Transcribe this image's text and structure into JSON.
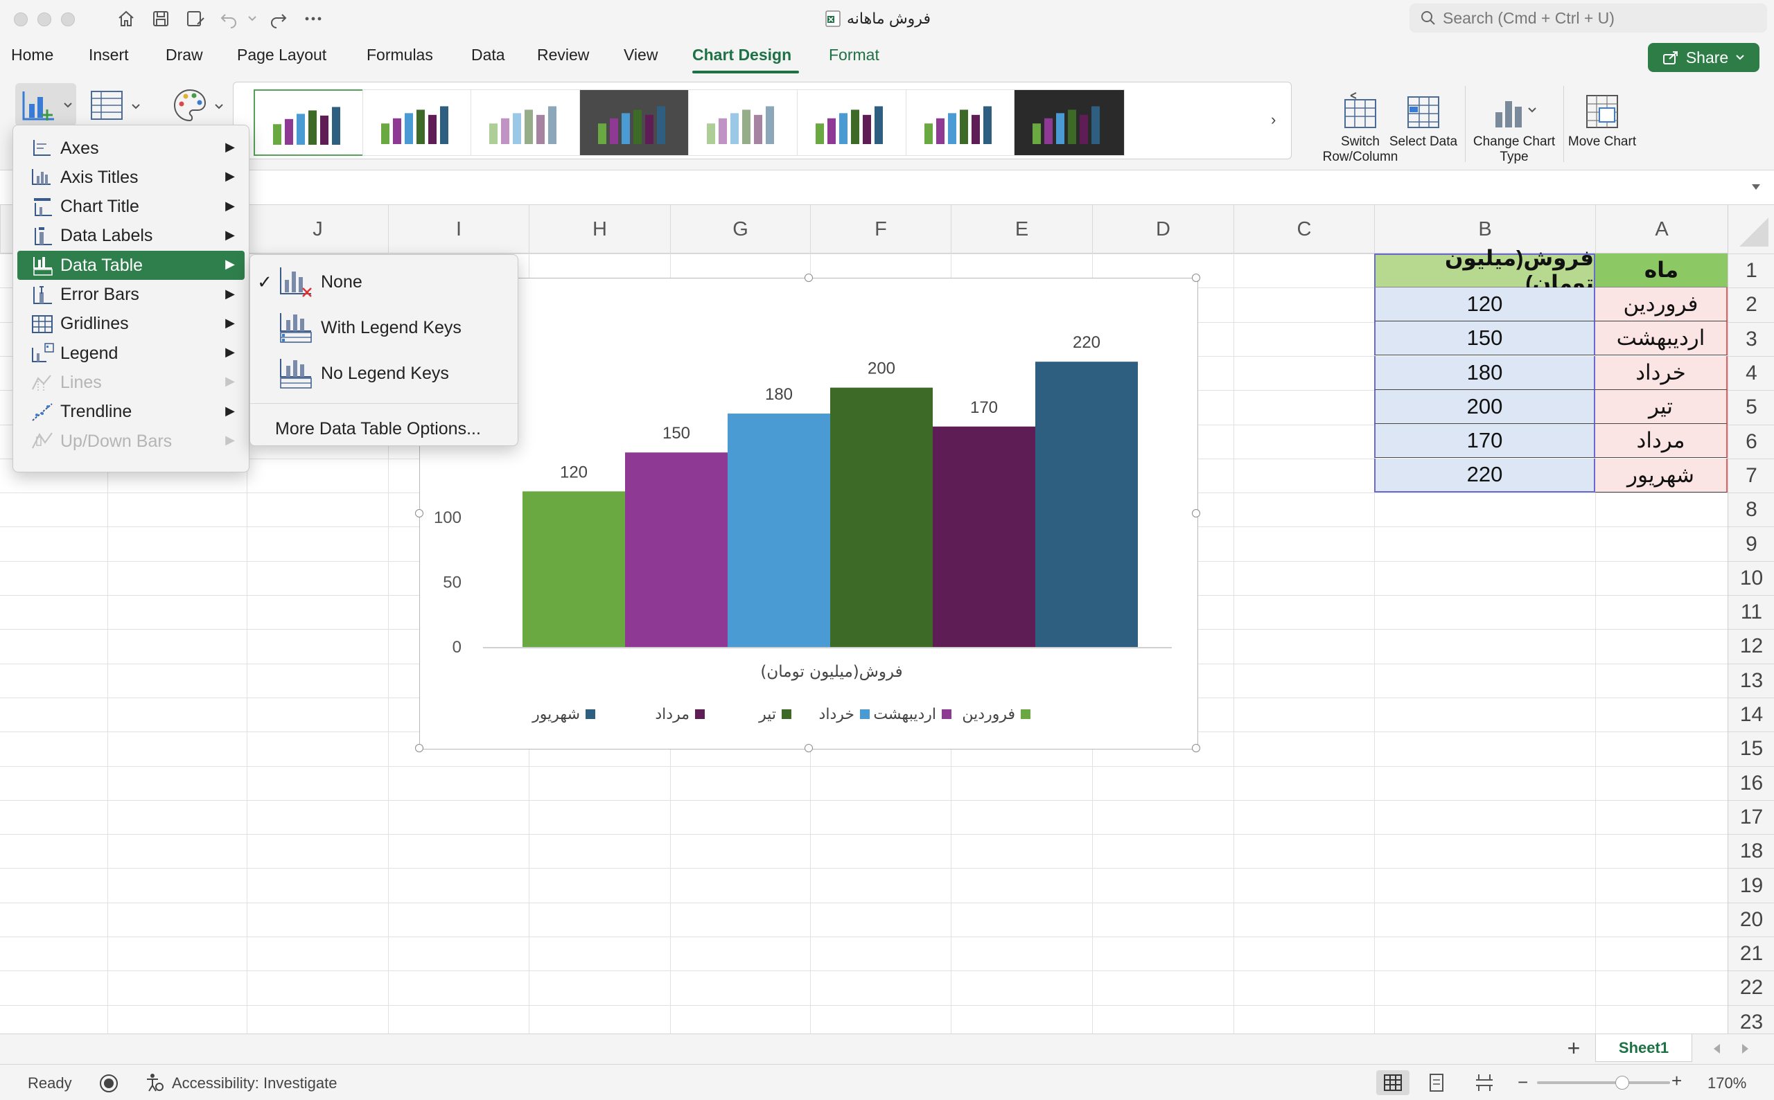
{
  "window": {
    "title": "فروش ماهانه",
    "search_placeholder": "Search (Cmd + Ctrl + U)"
  },
  "tabs": [
    "Home",
    "Insert",
    "Draw",
    "Page Layout",
    "Formulas",
    "Data",
    "Review",
    "View",
    "Chart Design",
    "Format"
  ],
  "active_tab": "Chart Design",
  "share_label": "Share",
  "ribbon": {
    "switch_row_column": "Switch Row/Column",
    "select_data": "Select Data",
    "change_chart_type": "Change Chart Type",
    "move_chart": "Move Chart"
  },
  "columns": [
    "J",
    "I",
    "H",
    "G",
    "F",
    "E",
    "D",
    "C",
    "B",
    "A"
  ],
  "rows": [
    "1",
    "2",
    "3",
    "4",
    "5",
    "6",
    "7",
    "8",
    "9",
    "10",
    "11",
    "12",
    "13",
    "14",
    "15",
    "16",
    "17",
    "18",
    "19",
    "20",
    "21",
    "22",
    "23"
  ],
  "sheet": {
    "header": {
      "month": "ماه",
      "sales": "فروش(میلیون تومان)"
    },
    "data": [
      {
        "month": "فروردین",
        "sales": "120"
      },
      {
        "month": "اردیبهشت",
        "sales": "150"
      },
      {
        "month": "خرداد",
        "sales": "180"
      },
      {
        "month": "تیر",
        "sales": "200"
      },
      {
        "month": "مرداد",
        "sales": "170"
      },
      {
        "month": "شهریور",
        "sales": "220"
      }
    ]
  },
  "chart_data": {
    "type": "bar",
    "categories": [
      "فروش(میلیون تومان)"
    ],
    "series": [
      {
        "name": "فروردین",
        "values": [
          120
        ],
        "color": "#6aa842"
      },
      {
        "name": "اردیبهشت",
        "values": [
          150
        ],
        "color": "#8e3a94"
      },
      {
        "name": "خرداد",
        "values": [
          180
        ],
        "color": "#4a9ad4"
      },
      {
        "name": "تیر",
        "values": [
          200
        ],
        "color": "#3e6a28"
      },
      {
        "name": "مرداد",
        "values": [
          170
        ],
        "color": "#5e1e55"
      },
      {
        "name": "شهریور",
        "values": [
          220
        ],
        "color": "#2e5f80"
      }
    ],
    "xlabel": "فروش(میلیون تومان)",
    "ylim": [
      0,
      250
    ],
    "yticks": [
      "0",
      "50",
      "100"
    ],
    "data_labels": [
      "120",
      "150",
      "180",
      "200",
      "170",
      "220"
    ],
    "legend_position": "bottom",
    "grid": false
  },
  "menu": {
    "items": [
      {
        "label": "Axes",
        "icon": "axes-icon",
        "enabled": true
      },
      {
        "label": "Axis Titles",
        "icon": "axis-titles-icon",
        "enabled": true
      },
      {
        "label": "Chart Title",
        "icon": "chart-title-icon",
        "enabled": true
      },
      {
        "label": "Data Labels",
        "icon": "data-labels-icon",
        "enabled": true
      },
      {
        "label": "Data Table",
        "icon": "data-table-icon",
        "enabled": true,
        "highlighted": true
      },
      {
        "label": "Error Bars",
        "icon": "error-bars-icon",
        "enabled": true
      },
      {
        "label": "Gridlines",
        "icon": "gridlines-icon",
        "enabled": true
      },
      {
        "label": "Legend",
        "icon": "legend-icon",
        "enabled": true
      },
      {
        "label": "Lines",
        "icon": "lines-icon",
        "enabled": false
      },
      {
        "label": "Trendline",
        "icon": "trendline-icon",
        "enabled": true
      },
      {
        "label": "Up/Down Bars",
        "icon": "up-down-bars-icon",
        "enabled": false
      }
    ]
  },
  "submenu": {
    "none": "None",
    "with_legend_keys": "With Legend Keys",
    "no_legend_keys": "No Legend Keys",
    "more": "More Data Table Options...",
    "checked": "None"
  },
  "sheet_tab": "Sheet1",
  "status": {
    "ready": "Ready",
    "accessibility": "Accessibility: Investigate",
    "zoom": "170%",
    "zoom_fraction": 0.64
  }
}
